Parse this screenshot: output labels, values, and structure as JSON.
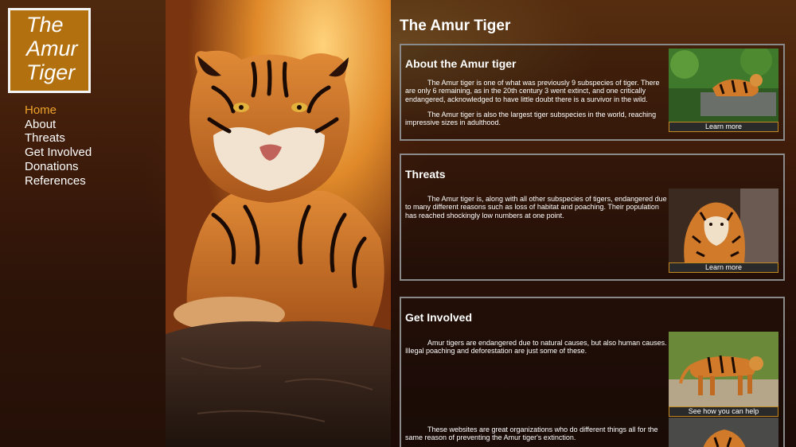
{
  "logo": {
    "line1": "The",
    "line2": "Amur",
    "line3": "Tiger"
  },
  "nav": {
    "items": [
      {
        "label": "Home"
      },
      {
        "label": "About"
      },
      {
        "label": "Threats"
      },
      {
        "label": "Get Involved"
      },
      {
        "label": "Donations"
      },
      {
        "label": "References"
      }
    ]
  },
  "main": {
    "title": "The Amur Tiger",
    "sections": [
      {
        "title": "About the Amur tiger",
        "paragraphs": [
          "The Amur tiger is one of what was previously 9 subspecies of tiger. There are only 6 remaining, as in the 20th century 3 went extinct, and one critically endangered, acknowledged to have little doubt there is a survivor in the wild.",
          "The Amur tiger is also the largest tiger subspecies in the world, reaching impressive sizes in adulthood."
        ],
        "button": "Learn more"
      },
      {
        "title": "Threats",
        "paragraphs": [
          "The Amur tiger is, along with all other subspecies of tigers, endangered due to many different reasons such as loss of habitat and poaching. Their population has reached shockingly low numbers at one point."
        ],
        "button": "Learn more"
      },
      {
        "title": "Get Involved",
        "paragraphs": [
          "Amur tigers are endangered due to natural causes, but also human causes. Illegal poaching and deforestation are just some of these.",
          "These websites are great organizations who do different things all for the same reason of preventing the Amur tiger's extinction."
        ],
        "button": "See how you can help"
      }
    ]
  },
  "colors": {
    "logo_bg": "#b2700f",
    "nav_active": "#f0a32a",
    "card_border": "#8a8a8a",
    "button_border": "#c48a20"
  }
}
